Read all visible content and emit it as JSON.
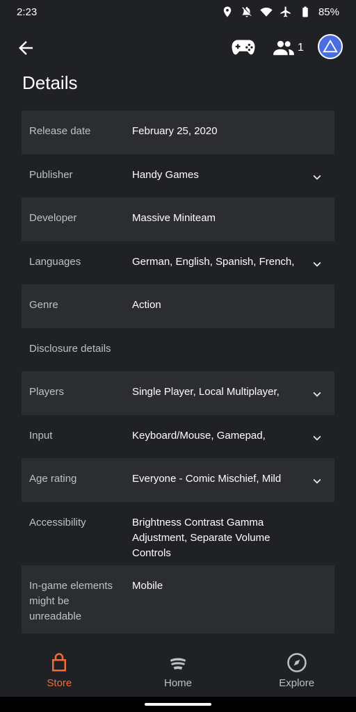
{
  "status": {
    "time": "2:23",
    "battery": "85%"
  },
  "header": {
    "friends_count": "1"
  },
  "page": {
    "title": "Details"
  },
  "rows": [
    {
      "label": "Release date",
      "value": "February 25, 2020"
    },
    {
      "label": "Publisher",
      "value": "Handy Games"
    },
    {
      "label": "Developer",
      "value": "Massive Miniteam"
    },
    {
      "label": "Languages",
      "value": "German, English, Spanish, French,"
    },
    {
      "label": "Genre",
      "value": "Action"
    },
    {
      "label": "Disclosure details",
      "value": ""
    },
    {
      "label": "Players",
      "value": "Single Player, Local Multiplayer,"
    },
    {
      "label": "Input",
      "value": "Keyboard/Mouse, Gamepad,"
    },
    {
      "label": "Age rating",
      "value": "Everyone - Comic Mischief, Mild"
    },
    {
      "label": "Accessibility",
      "value": "Brightness Contrast Gamma Adjustment, Separate Volume Controls"
    },
    {
      "label": "In-game elements might be unreadable",
      "value": "Mobile"
    }
  ],
  "nav": {
    "store": "Store",
    "home": "Home",
    "explore": "Explore",
    "active_color": "#f26b3a"
  }
}
